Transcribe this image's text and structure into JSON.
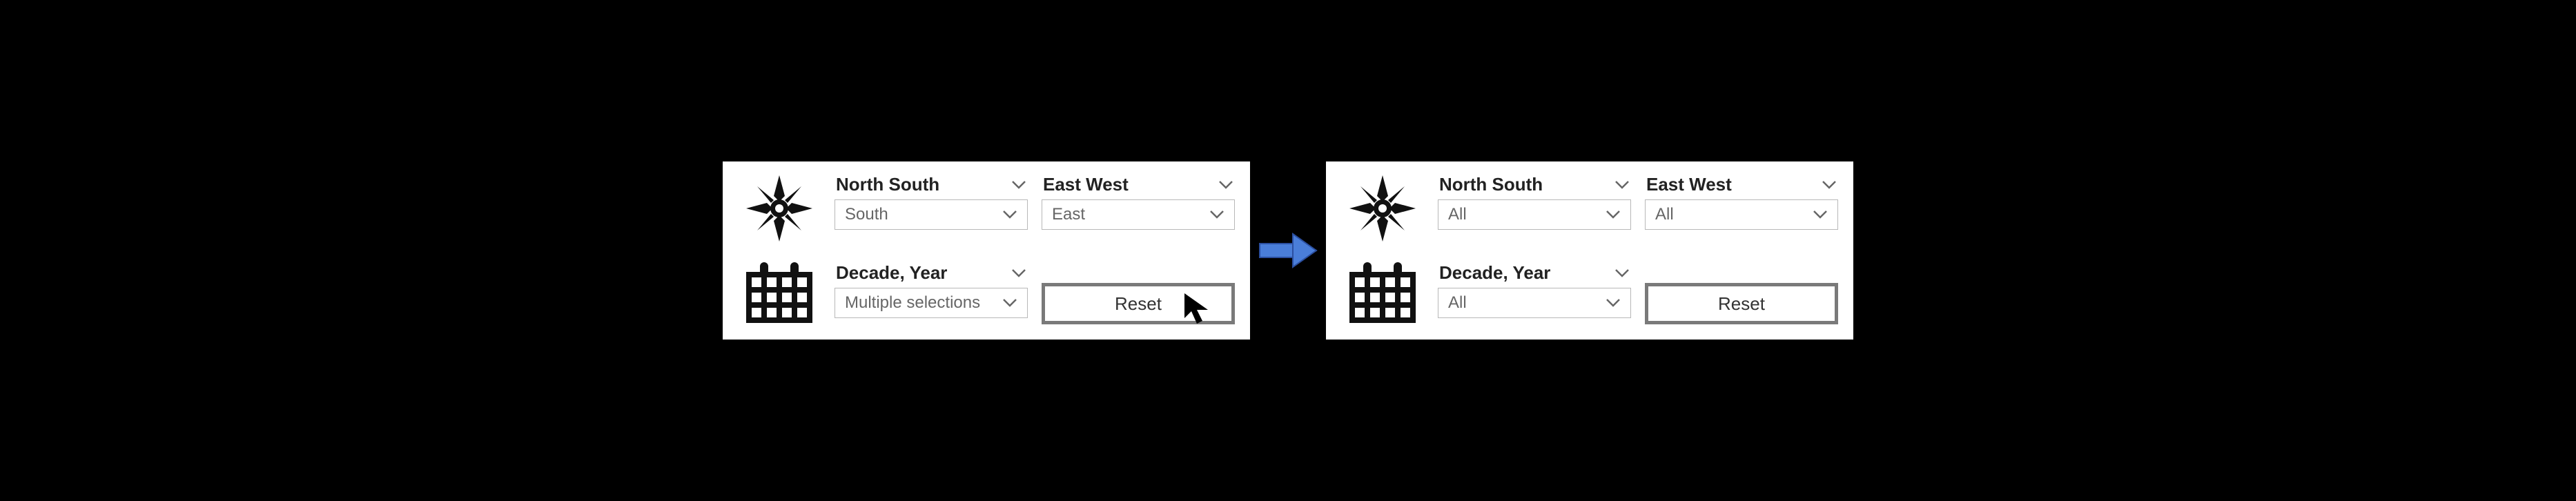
{
  "left_panel": {
    "north_south": {
      "label": "North South",
      "value": "South"
    },
    "east_west": {
      "label": "East West",
      "value": "East"
    },
    "decade_year": {
      "label": "Decade, Year",
      "value": "Multiple selections"
    },
    "reset_label": "Reset"
  },
  "right_panel": {
    "north_south": {
      "label": "North South",
      "value": "All"
    },
    "east_west": {
      "label": "East West",
      "value": "All"
    },
    "decade_year": {
      "label": "Decade, Year",
      "value": "All"
    },
    "reset_label": "Reset"
  }
}
